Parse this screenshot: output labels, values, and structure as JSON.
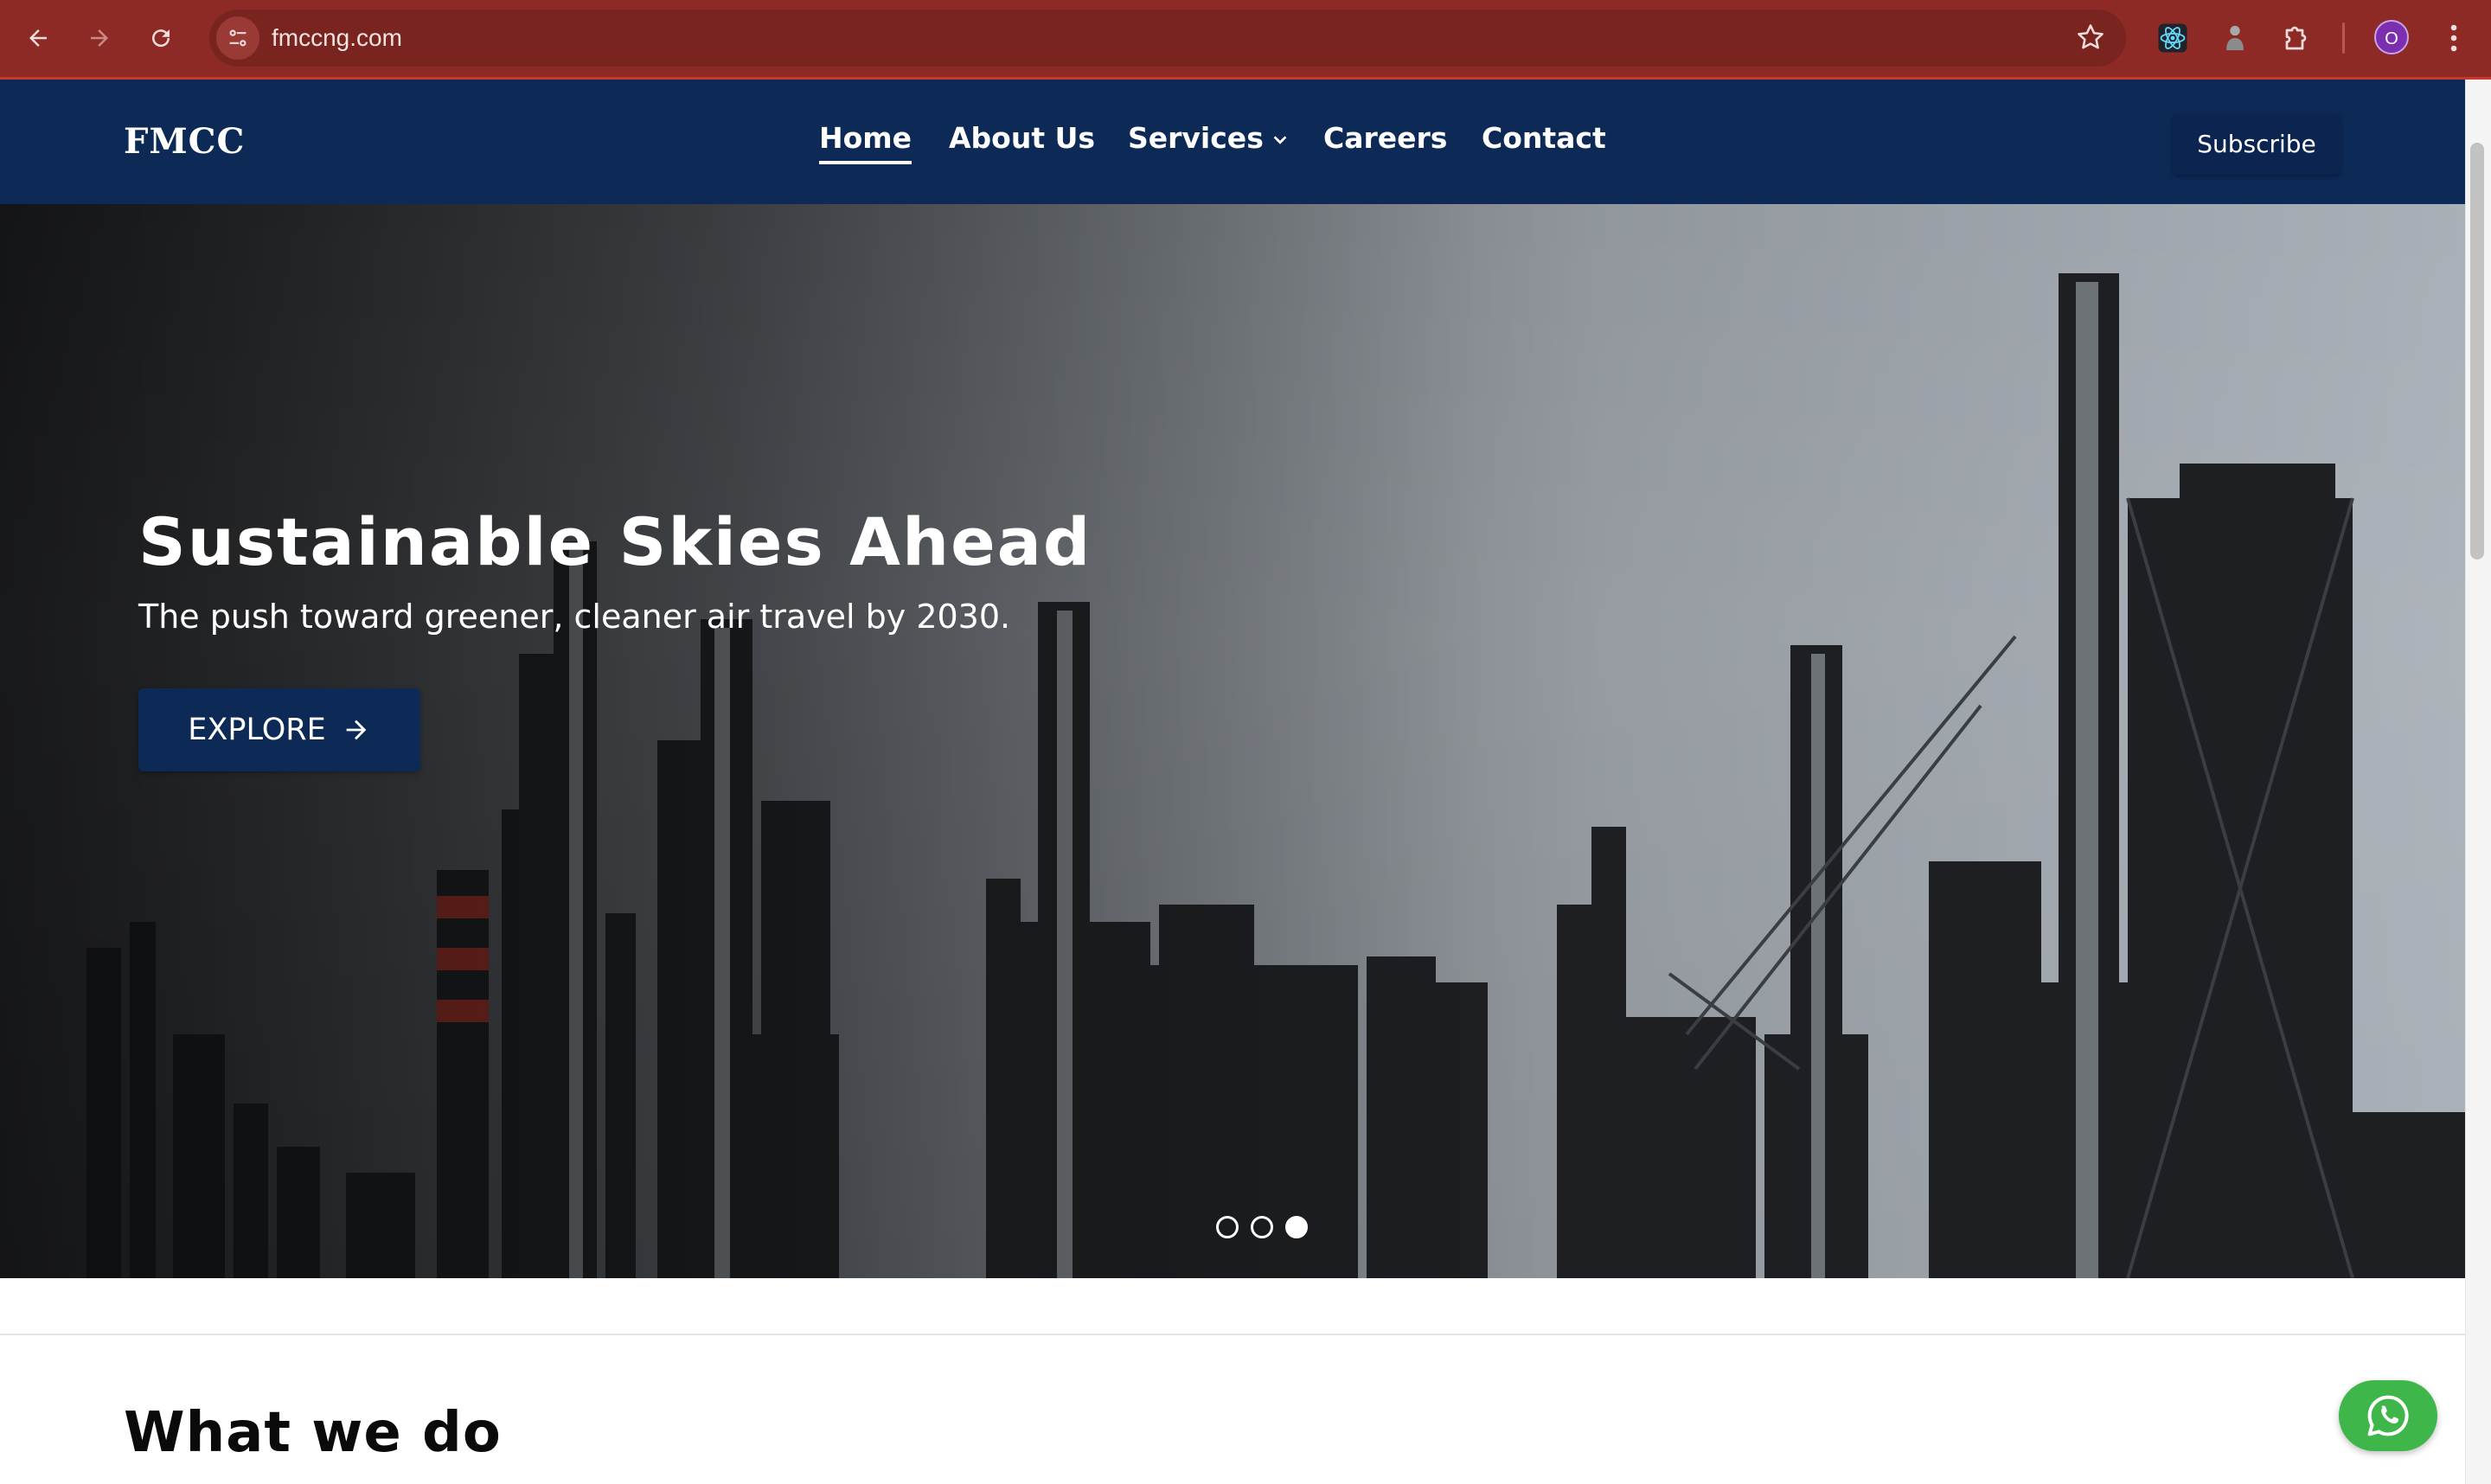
{
  "browser": {
    "url": "fmccng.com",
    "profile_initial": "O",
    "colors": {
      "frame": "#8e2a26",
      "omnibox": "#7a2420"
    },
    "icons": [
      "back-icon",
      "forward-icon",
      "reload-icon",
      "site-info-icon",
      "bookmark-star-icon",
      "react-devtools-icon",
      "extension-icon",
      "puzzle-extensions-icon",
      "more-menu-icon"
    ]
  },
  "site": {
    "logo": "FMCC",
    "nav": {
      "home": "Home",
      "about": "About Us",
      "services": "Services",
      "careers": "Careers",
      "contact": "Contact",
      "active": "Home"
    },
    "subscribe_label": "Subscribe",
    "colors": {
      "navy": "#0d2a57",
      "whatsapp": "#3fb64a"
    }
  },
  "hero": {
    "title": "Sustainable Skies Ahead",
    "subtitle": "The push toward greener, cleaner air travel by 2030.",
    "cta_label": "EXPLORE",
    "slides_total": 3,
    "active_slide": 3
  },
  "section": {
    "title": "What we do"
  }
}
